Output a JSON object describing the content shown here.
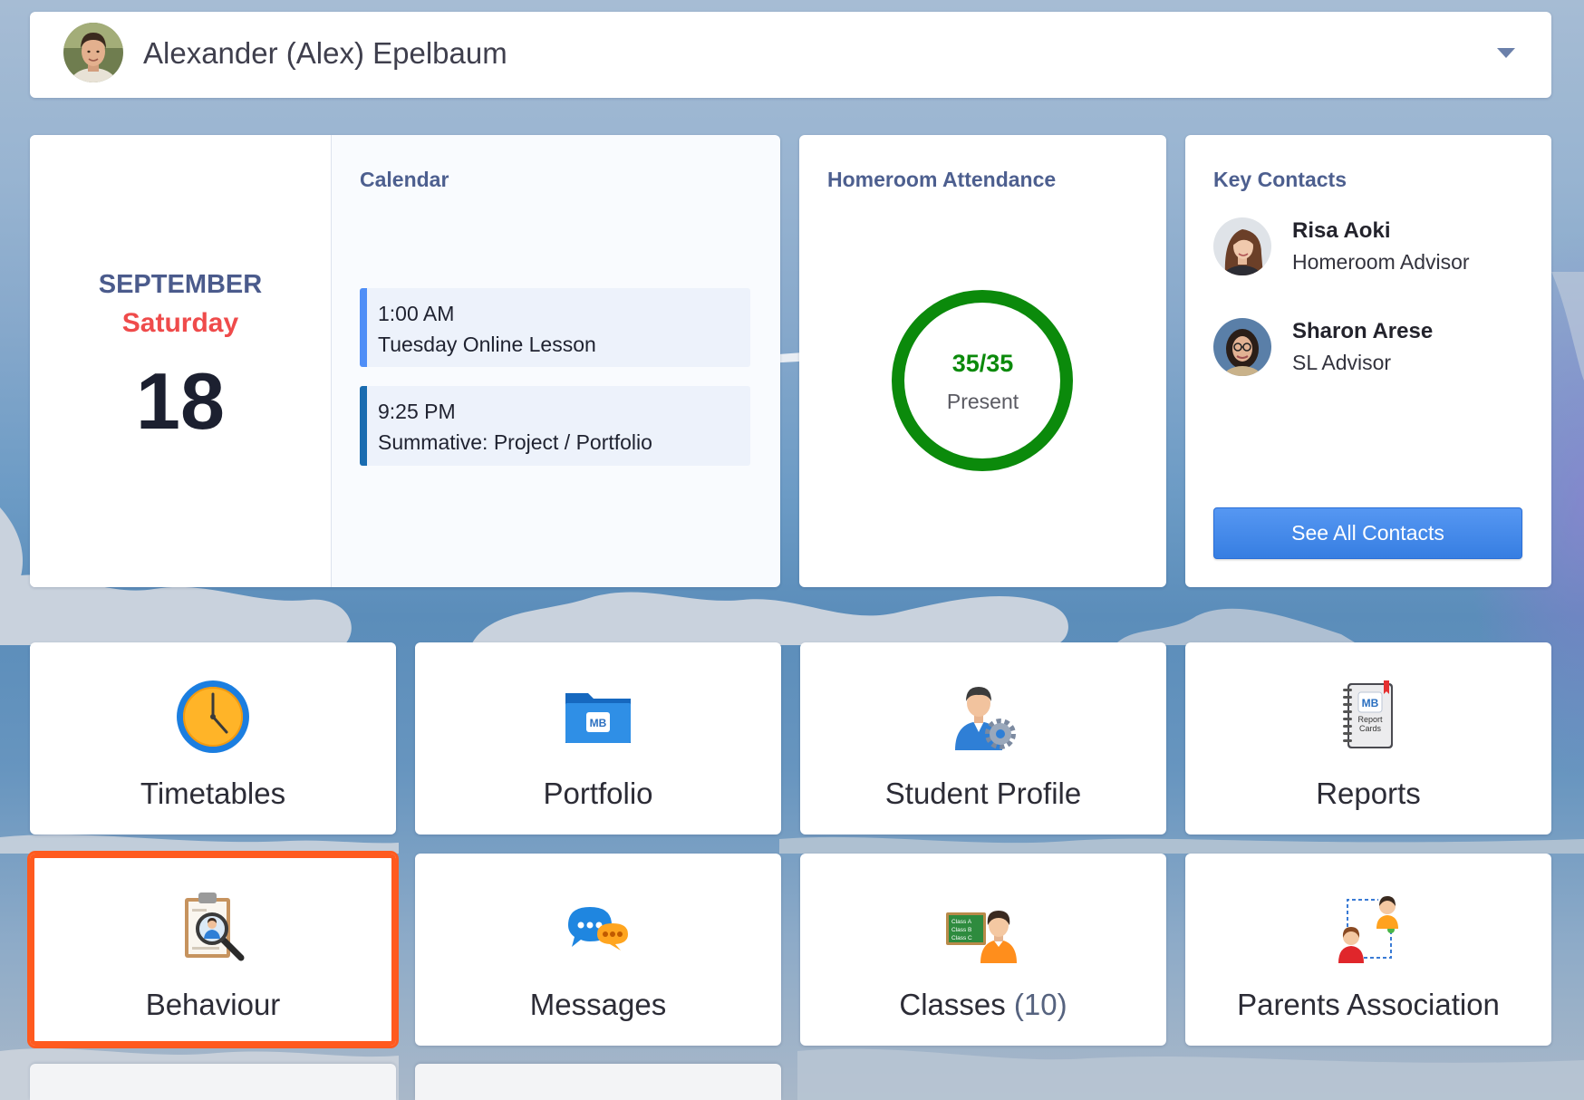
{
  "theme": {
    "accent": "#3a86f0",
    "highlight": "#ff5a1f",
    "title": "#4d5f8f",
    "month": "#4b5b8c",
    "weekday": "#ef4b4b",
    "attendance": "#0b8a0b",
    "count": "#56637f"
  },
  "header": {
    "student_name": "Alexander (Alex) Epelbaum",
    "avatar_icon": "student-avatar-icon",
    "dropdown_icon": "caret-down-icon"
  },
  "date": {
    "month": "SEPTEMBER",
    "weekday": "Saturday",
    "day": "18"
  },
  "calendar": {
    "title": "Calendar",
    "events": [
      {
        "time": "1:00 AM",
        "title": "Tuesday Online Lesson",
        "color": "#4f8ef7"
      },
      {
        "time": "9:25 PM",
        "title": "Summative: Project / Portfolio",
        "color": "#1a6cb0"
      }
    ]
  },
  "attendance": {
    "title": "Homeroom Attendance",
    "value": "35/35",
    "label": "Present",
    "ring_fraction": 1
  },
  "contacts": {
    "title": "Key Contacts",
    "items": [
      {
        "name": "Risa Aoki",
        "role": "Homeroom Advisor",
        "avatar_icon": "contact-avatar-icon"
      },
      {
        "name": "Sharon Arese",
        "role": "SL Advisor",
        "avatar_icon": "contact-avatar-icon"
      }
    ],
    "button_label": "See All Contacts"
  },
  "tiles": [
    {
      "label": "Timetables",
      "icon": "clock-icon"
    },
    {
      "label": "Portfolio",
      "icon": "portfolio-folder-icon",
      "icon_text": [
        "MB"
      ]
    },
    {
      "label": "Student Profile",
      "icon": "student-profile-icon"
    },
    {
      "label": "Reports",
      "icon": "report-cards-icon",
      "icon_text": [
        "MB",
        "Report",
        "Cards"
      ]
    },
    {
      "label": "Behaviour",
      "icon": "behaviour-clipboard-icon",
      "selected": true
    },
    {
      "label": "Messages",
      "icon": "messages-icon"
    },
    {
      "label": "Classes",
      "count": "(10)",
      "icon": "classes-icon",
      "icon_text": [
        "Class A",
        "Class B",
        "Class C"
      ]
    },
    {
      "label": "Parents Association",
      "icon": "parents-association-icon"
    }
  ]
}
